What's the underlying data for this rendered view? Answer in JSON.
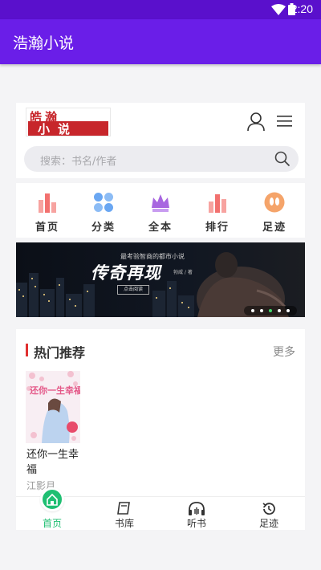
{
  "status_bar": {
    "time": "2:20"
  },
  "app_bar": {
    "title": "浩瀚小说"
  },
  "header": {
    "logo_top": "皓瀚",
    "logo_bottom": "小说",
    "search_placeholder": "搜索：书名/作者"
  },
  "nav": [
    {
      "label": "首页",
      "icon": "bar-chart-icon",
      "color": "#f2716f"
    },
    {
      "label": "分类",
      "icon": "grid-dots-icon",
      "color": "#5b9cf0"
    },
    {
      "label": "全本",
      "icon": "crown-icon",
      "color": "#9b59d9"
    },
    {
      "label": "排行",
      "icon": "ranking-icon",
      "color": "#f2716f"
    },
    {
      "label": "足迹",
      "icon": "footprint-icon",
      "color": "#f39a4e"
    }
  ],
  "banner": {
    "slogan": "最考验智商的都市小说",
    "headline": "传奇再现",
    "author": "勃威 / 著",
    "button": "点击阅读",
    "dots_total": 5,
    "dots_active": 3
  },
  "hot": {
    "title": "热门推荐",
    "more": "更多",
    "books": [
      {
        "title": "还你一生幸福",
        "author": "江影月",
        "cover_title": "还你一生幸福"
      }
    ]
  },
  "tabs": [
    {
      "label": "首页",
      "icon": "home-icon",
      "active": true
    },
    {
      "label": "书库",
      "icon": "book-icon",
      "active": false
    },
    {
      "label": "听书",
      "icon": "headphones-icon",
      "active": false
    },
    {
      "label": "足迹",
      "icon": "history-icon",
      "active": false
    }
  ],
  "colors": {
    "status_bar": "#5a10cc",
    "app_bar": "#6a1ee8",
    "accent_green": "#1fbf72",
    "hot_bar": "#e03030",
    "logo_red": "#c7262b"
  }
}
